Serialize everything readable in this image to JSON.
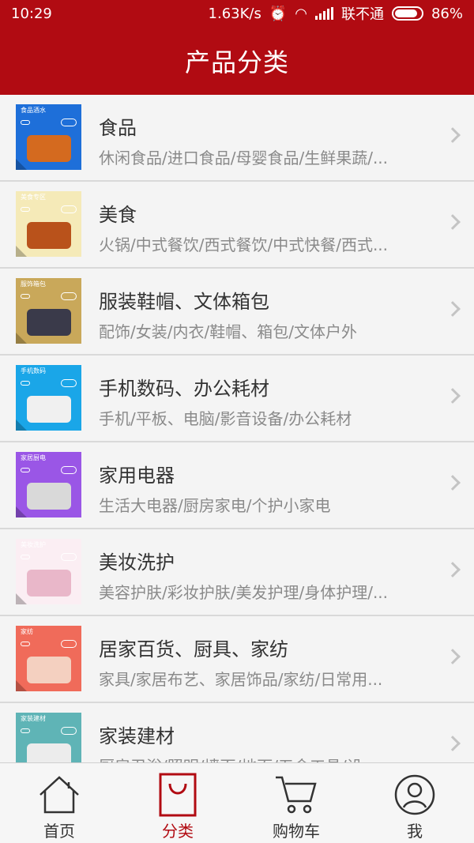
{
  "status": {
    "time": "10:29",
    "speed": "1.63K/s",
    "carrier": "联不通",
    "battery": "86%"
  },
  "header": {
    "title": "产品分类"
  },
  "categories": [
    {
      "title": "食品",
      "subtitle": "休闲食品/进口食品/母婴食品/生鲜果蔬/...",
      "thumb_label": "食品酒水",
      "thumb_color": "#1e6fd9",
      "obj_color": "#d46a1f"
    },
    {
      "title": "美食",
      "subtitle": "火锅/中式餐饮/西式餐饮/中式快餐/西式...",
      "thumb_label": "美食专区",
      "thumb_color": "#f5eab8",
      "obj_color": "#b9521b"
    },
    {
      "title": "服装鞋帽、文体箱包",
      "subtitle": "配饰/女装/内衣/鞋帽、箱包/文体户外",
      "thumb_label": "服饰箱包",
      "thumb_color": "#c9a85a",
      "obj_color": "#3a3a4a"
    },
    {
      "title": "手机数码、办公耗材",
      "subtitle": "手机/平板、电脑/影音设备/办公耗材",
      "thumb_label": "手机数码",
      "thumb_color": "#1aa6e8",
      "obj_color": "#f0f0f0"
    },
    {
      "title": "家用电器",
      "subtitle": "生活大电器/厨房家电/个护小家电",
      "thumb_label": "家居厨电",
      "thumb_color": "#9a56e6",
      "obj_color": "#d9d9d9"
    },
    {
      "title": "美妆洗护",
      "subtitle": "美容护肤/彩妆护肤/美发护理/身体护理/...",
      "thumb_label": "美妆洗护",
      "thumb_color": "#fbeef3",
      "obj_color": "#e9b7c9"
    },
    {
      "title": "居家百货、厨具、家纺",
      "subtitle": "家具/家居布艺、家居饰品/家纺/日常用...",
      "thumb_label": "家纺",
      "thumb_color": "#f06b5a",
      "obj_color": "#f4d0c0"
    },
    {
      "title": "家装建材",
      "subtitle": "厨房卫浴/照明/墙面/地面/五金工具/设...",
      "thumb_label": "家装建材",
      "thumb_color": "#5fb4b6",
      "obj_color": "#ececec"
    }
  ],
  "tabs": [
    {
      "label": "首页",
      "icon": "home-icon",
      "active": false
    },
    {
      "label": "分类",
      "icon": "shopping-bag-icon",
      "active": true
    },
    {
      "label": "购物车",
      "icon": "cart-icon",
      "active": false
    },
    {
      "label": "我",
      "icon": "user-icon",
      "active": false
    }
  ],
  "colors": {
    "brand": "#b10b12",
    "text": "#333333",
    "subtext": "#8a8a8a"
  }
}
